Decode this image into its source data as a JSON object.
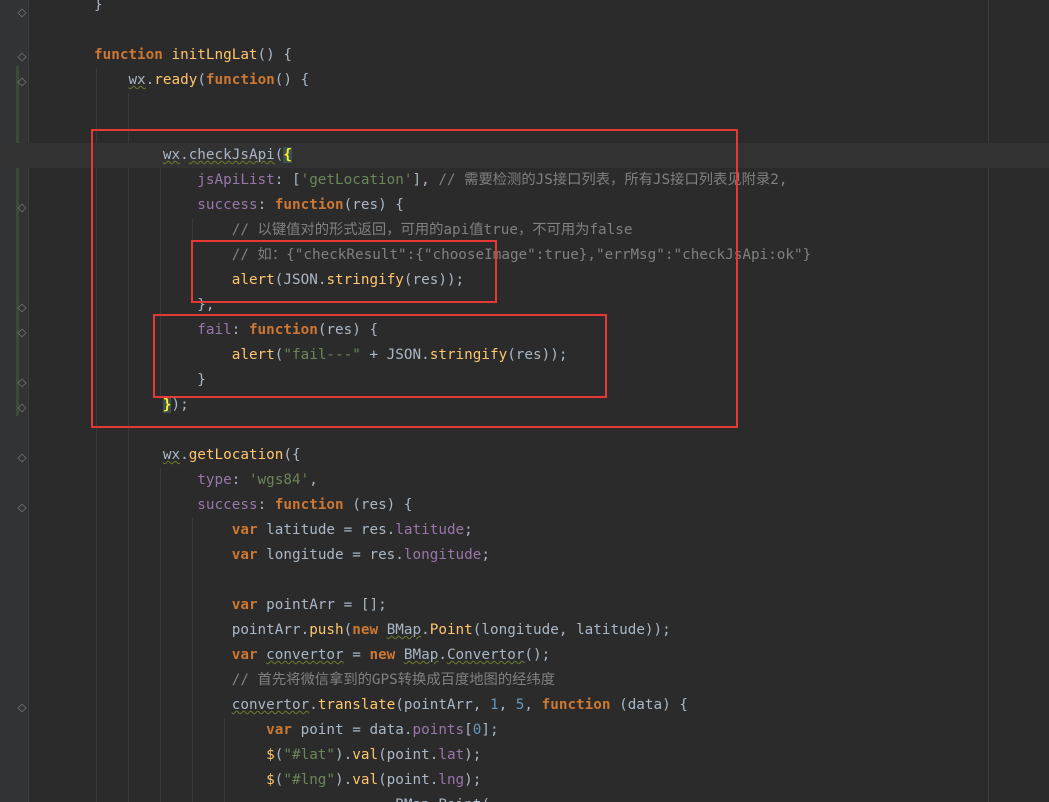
{
  "editor": {
    "language": "javascript",
    "accent_color": "#e53935",
    "lines": [
      {
        "tokens": [
          {
            "t": "}",
            "c": "plain"
          }
        ]
      },
      {
        "tokens": []
      },
      {
        "tokens": [
          {
            "t": "function ",
            "c": "kw"
          },
          {
            "t": "initLngLat",
            "c": "fn"
          },
          {
            "t": "() {",
            "c": "plain"
          }
        ]
      },
      {
        "tokens": [
          {
            "t": "    ",
            "c": "plain"
          },
          {
            "t": "wx",
            "c": "sq"
          },
          {
            "t": ".",
            "c": "plain"
          },
          {
            "t": "ready",
            "c": "fn"
          },
          {
            "t": "(",
            "c": "plain"
          },
          {
            "t": "function",
            "c": "kw"
          },
          {
            "t": "() {",
            "c": "plain"
          }
        ]
      },
      {
        "tokens": []
      },
      {
        "tokens": []
      },
      {
        "tokens": [
          {
            "t": "        ",
            "c": "plain"
          },
          {
            "t": "wx",
            "c": "sq"
          },
          {
            "t": ".",
            "c": "plain"
          },
          {
            "t": "checkJsApi",
            "c": "sq"
          },
          {
            "t": "(",
            "c": "plain"
          },
          {
            "t": "{",
            "c": "brace-hl"
          }
        ]
      },
      {
        "tokens": [
          {
            "t": "            ",
            "c": "plain"
          },
          {
            "t": "jsApiList",
            "c": "prop"
          },
          {
            "t": ": [",
            "c": "plain"
          },
          {
            "t": "'getLocation'",
            "c": "str"
          },
          {
            "t": "], ",
            "c": "plain"
          },
          {
            "t": "// 需要检测的JS接口列表，所有JS接口列表见附录2,",
            "c": "cm"
          }
        ]
      },
      {
        "tokens": [
          {
            "t": "            ",
            "c": "plain"
          },
          {
            "t": "success",
            "c": "prop"
          },
          {
            "t": ": ",
            "c": "plain"
          },
          {
            "t": "function",
            "c": "kw"
          },
          {
            "t": "(res) {",
            "c": "plain"
          }
        ]
      },
      {
        "tokens": [
          {
            "t": "                ",
            "c": "plain"
          },
          {
            "t": "// 以键值对的形式返回，可用的api值true，不可用为false",
            "c": "cm"
          }
        ]
      },
      {
        "tokens": [
          {
            "t": "                ",
            "c": "plain"
          },
          {
            "t": "// 如：{\"checkResult\":{\"chooseImage\":true},\"errMsg\":\"checkJsApi:ok\"}",
            "c": "cm"
          }
        ]
      },
      {
        "tokens": [
          {
            "t": "                ",
            "c": "plain"
          },
          {
            "t": "alert",
            "c": "fn"
          },
          {
            "t": "(JSON.",
            "c": "plain"
          },
          {
            "t": "stringify",
            "c": "fn"
          },
          {
            "t": "(res));",
            "c": "plain"
          }
        ]
      },
      {
        "tokens": [
          {
            "t": "            },",
            "c": "plain"
          }
        ]
      },
      {
        "tokens": [
          {
            "t": "            ",
            "c": "plain"
          },
          {
            "t": "fail",
            "c": "prop"
          },
          {
            "t": ": ",
            "c": "plain"
          },
          {
            "t": "function",
            "c": "kw"
          },
          {
            "t": "(res) {",
            "c": "plain"
          }
        ]
      },
      {
        "tokens": [
          {
            "t": "                ",
            "c": "plain"
          },
          {
            "t": "alert",
            "c": "fn"
          },
          {
            "t": "(",
            "c": "plain"
          },
          {
            "t": "\"fail---\"",
            "c": "str"
          },
          {
            "t": " + JSON.",
            "c": "plain"
          },
          {
            "t": "stringify",
            "c": "fn"
          },
          {
            "t": "(res));",
            "c": "plain"
          }
        ]
      },
      {
        "tokens": [
          {
            "t": "            }",
            "c": "plain"
          }
        ]
      },
      {
        "tokens": [
          {
            "t": "        ",
            "c": "plain"
          },
          {
            "t": "}",
            "c": "brace-hl"
          },
          {
            "t": ");",
            "c": "plain"
          }
        ]
      },
      {
        "tokens": []
      },
      {
        "tokens": [
          {
            "t": "        ",
            "c": "plain"
          },
          {
            "t": "wx",
            "c": "sq"
          },
          {
            "t": ".",
            "c": "plain"
          },
          {
            "t": "getLocation",
            "c": "fn"
          },
          {
            "t": "({",
            "c": "plain"
          }
        ]
      },
      {
        "tokens": [
          {
            "t": "            ",
            "c": "plain"
          },
          {
            "t": "type",
            "c": "prop"
          },
          {
            "t": ": ",
            "c": "plain"
          },
          {
            "t": "'wgs84'",
            "c": "str"
          },
          {
            "t": ",",
            "c": "plain"
          }
        ]
      },
      {
        "tokens": [
          {
            "t": "            ",
            "c": "plain"
          },
          {
            "t": "success",
            "c": "prop"
          },
          {
            "t": ": ",
            "c": "plain"
          },
          {
            "t": "function ",
            "c": "kw"
          },
          {
            "t": "(res) {",
            "c": "plain"
          }
        ]
      },
      {
        "tokens": [
          {
            "t": "                ",
            "c": "plain"
          },
          {
            "t": "var ",
            "c": "kw"
          },
          {
            "t": "latitude = res.",
            "c": "plain"
          },
          {
            "t": "latitude",
            "c": "prop"
          },
          {
            "t": ";",
            "c": "plain"
          }
        ]
      },
      {
        "tokens": [
          {
            "t": "                ",
            "c": "plain"
          },
          {
            "t": "var ",
            "c": "kw"
          },
          {
            "t": "longitude = res.",
            "c": "plain"
          },
          {
            "t": "longitude",
            "c": "prop"
          },
          {
            "t": ";",
            "c": "plain"
          }
        ]
      },
      {
        "tokens": []
      },
      {
        "tokens": [
          {
            "t": "                ",
            "c": "plain"
          },
          {
            "t": "var ",
            "c": "kw"
          },
          {
            "t": "pointArr = [];",
            "c": "plain"
          }
        ]
      },
      {
        "tokens": [
          {
            "t": "                ",
            "c": "plain"
          },
          {
            "t": "pointArr.",
            "c": "plain"
          },
          {
            "t": "push",
            "c": "fn"
          },
          {
            "t": "(",
            "c": "plain"
          },
          {
            "t": "new ",
            "c": "kw"
          },
          {
            "t": "BMap",
            "c": "sq"
          },
          {
            "t": ".",
            "c": "plain"
          },
          {
            "t": "Point",
            "c": "fn"
          },
          {
            "t": "(longitude, latitude));",
            "c": "plain"
          }
        ]
      },
      {
        "tokens": [
          {
            "t": "                ",
            "c": "plain"
          },
          {
            "t": "var ",
            "c": "kw"
          },
          {
            "t": "convertor",
            "c": "sq"
          },
          {
            "t": " = ",
            "c": "plain"
          },
          {
            "t": "new ",
            "c": "kw"
          },
          {
            "t": "BMap",
            "c": "sq"
          },
          {
            "t": ".",
            "c": "plain"
          },
          {
            "t": "Convertor",
            "c": "sq"
          },
          {
            "t": "();",
            "c": "plain"
          }
        ]
      },
      {
        "tokens": [
          {
            "t": "                ",
            "c": "plain"
          },
          {
            "t": "// 首先将微信拿到的GPS转换成百度地图的经纬度",
            "c": "cm"
          }
        ]
      },
      {
        "tokens": [
          {
            "t": "                ",
            "c": "plain"
          },
          {
            "t": "convertor",
            "c": "sq"
          },
          {
            "t": ".",
            "c": "plain"
          },
          {
            "t": "translate",
            "c": "fn"
          },
          {
            "t": "(pointArr, ",
            "c": "plain"
          },
          {
            "t": "1",
            "c": "num"
          },
          {
            "t": ", ",
            "c": "plain"
          },
          {
            "t": "5",
            "c": "num"
          },
          {
            "t": ", ",
            "c": "plain"
          },
          {
            "t": "function ",
            "c": "kw"
          },
          {
            "t": "(data) {",
            "c": "plain"
          }
        ]
      },
      {
        "tokens": [
          {
            "t": "                    ",
            "c": "plain"
          },
          {
            "t": "var ",
            "c": "kw"
          },
          {
            "t": "point = data.",
            "c": "plain"
          },
          {
            "t": "points",
            "c": "prop"
          },
          {
            "t": "[",
            "c": "plain"
          },
          {
            "t": "0",
            "c": "num"
          },
          {
            "t": "];",
            "c": "plain"
          }
        ]
      },
      {
        "tokens": [
          {
            "t": "                    ",
            "c": "plain"
          },
          {
            "t": "$",
            "c": "fn"
          },
          {
            "t": "(",
            "c": "plain"
          },
          {
            "t": "\"#lat\"",
            "c": "str"
          },
          {
            "t": ").",
            "c": "plain"
          },
          {
            "t": "val",
            "c": "fn"
          },
          {
            "t": "(point.",
            "c": "plain"
          },
          {
            "t": "lat",
            "c": "prop"
          },
          {
            "t": ");",
            "c": "plain"
          }
        ]
      },
      {
        "tokens": [
          {
            "t": "                    ",
            "c": "plain"
          },
          {
            "t": "$",
            "c": "fn"
          },
          {
            "t": "(",
            "c": "plain"
          },
          {
            "t": "\"#lng\"",
            "c": "str"
          },
          {
            "t": ").",
            "c": "plain"
          },
          {
            "t": "val",
            "c": "fn"
          },
          {
            "t": "(point.",
            "c": "plain"
          },
          {
            "t": "lng",
            "c": "prop"
          },
          {
            "t": ");",
            "c": "plain"
          }
        ]
      },
      {
        "tokens": [
          {
            "t": "                                   ",
            "c": "plain"
          },
          {
            "t": "BMap.Point(",
            "c": "plain"
          }
        ]
      }
    ]
  }
}
